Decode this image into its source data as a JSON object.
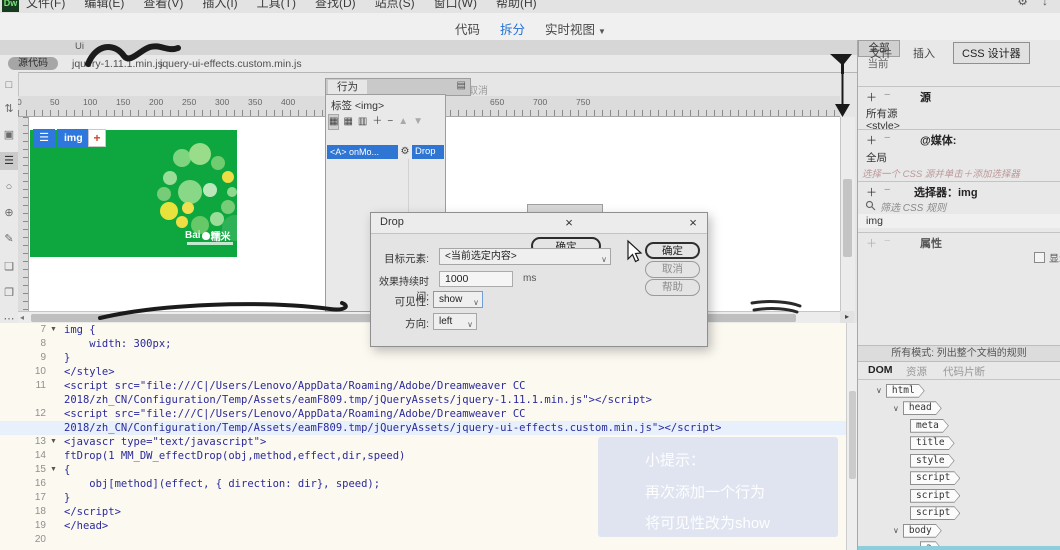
{
  "menu_bar": {
    "items": [
      "文件(F)",
      "编辑(E)",
      "查看(V)",
      "插入(I)",
      "工具(T)",
      "查找(D)",
      "站点(S)",
      "窗口(W)",
      "帮助(H)"
    ],
    "logo": "Dw"
  },
  "view_toolbar": {
    "code": "代码",
    "split": "拆分",
    "live": "实时视图"
  },
  "document_tabs": {
    "partial_title": "Ui"
  },
  "related_files": {
    "source": "源代码",
    "files": [
      "jquery-1.11.1.min.js",
      "jquery-ui-effects.custom.min.js"
    ]
  },
  "left_toolbar": {
    "icons": [
      {
        "name": "file-icon",
        "glyph": "□"
      },
      {
        "name": "manage-files-icon",
        "glyph": "⇅"
      },
      {
        "name": "live-view-icon",
        "glyph": "▣"
      },
      {
        "name": "format-menu-icon",
        "glyph": "☰",
        "active": true
      },
      {
        "name": "circle-marker-icon",
        "glyph": "○"
      },
      {
        "name": "guides-icon",
        "glyph": "⊕"
      },
      {
        "name": "edit-tool-icon",
        "glyph": "✎"
      },
      {
        "name": "comment-icon",
        "glyph": "❏"
      },
      {
        "name": "comment-remove-icon",
        "glyph": "❐"
      },
      {
        "name": "more-tools-icon",
        "glyph": "⋯"
      }
    ]
  },
  "design_view": {
    "img_badge": "img",
    "hud_menu_icon": "☰",
    "hud_plus": "+",
    "ruler": {
      "left_ticks": [
        "0",
        "50",
        "100",
        "150",
        "200",
        "250",
        "300",
        "350",
        "400"
      ],
      "right_ticks": [
        "650",
        "700",
        "750"
      ]
    },
    "image": {
      "logo_primary": "Bai",
      "logo_secondary": "糯米",
      "background_color": "#0ea73f",
      "bubbles": [
        [
          152,
          28,
          9,
          "#7fd47f"
        ],
        [
          170,
          24,
          11,
          "#99dd8a"
        ],
        [
          188,
          33,
          7,
          "#6fcc6f"
        ],
        [
          198,
          47,
          6,
          "#eedd44"
        ],
        [
          202,
          62,
          5,
          "#8fd98f"
        ],
        [
          198,
          77,
          7,
          "#77cc77"
        ],
        [
          187,
          89,
          7,
          "#99dd99"
        ],
        [
          170,
          95,
          9,
          "#66c866"
        ],
        [
          152,
          92,
          6,
          "#eedd44"
        ],
        [
          139,
          81,
          9,
          "#e8e23c"
        ],
        [
          134,
          64,
          7,
          "#77cc77"
        ],
        [
          140,
          48,
          7,
          "#99dd99"
        ],
        [
          160,
          62,
          12,
          "#88d888"
        ],
        [
          180,
          60,
          7,
          "#bbe8bb"
        ],
        [
          158,
          78,
          6,
          "#f0e050"
        ],
        [
          205,
          98,
          13,
          "#2fb157"
        ]
      ]
    }
  },
  "behaviors_panel": {
    "title": "行为",
    "menu_icon": "▤",
    "tag_label": "标签 <img>",
    "toolbar_icons": [
      {
        "name": "show-set-events-icon",
        "glyph": "▦",
        "pressed": true
      },
      {
        "name": "show-all-events-icon",
        "glyph": "▦"
      },
      {
        "name": "events-column-icon",
        "glyph": "▥"
      },
      {
        "name": "add-behavior-button",
        "glyph": "＋"
      },
      {
        "name": "remove-behavior-button",
        "glyph": "−"
      },
      {
        "name": "move-up-button",
        "glyph": "▲",
        "disabled": true
      },
      {
        "name": "move-down-button",
        "glyph": "▼",
        "disabled": true
      }
    ],
    "event": "<A> onMo...",
    "gear_icon": "⚙",
    "action": "Drop",
    "hidden_text": "取消"
  },
  "drop_dialog": {
    "title": "Drop",
    "close_icon": "×",
    "ghost_ok": "确定",
    "target_label": "目标元素:",
    "target_value": "<当前选定内容>",
    "duration_label": "效果持续时间:",
    "duration_value": "1000",
    "duration_unit": "ms",
    "visibility_label": "可见性:",
    "visibility_value": "show",
    "direction_label": "方向:",
    "direction_value": "left",
    "ok": "确定",
    "cancel": "取消",
    "help": "帮助"
  },
  "code_editor": {
    "rows": [
      {
        "n": "7",
        "fold": true,
        "text": "img {"
      },
      {
        "n": "8",
        "text": "    width: 300px;"
      },
      {
        "n": "9",
        "text": "}"
      },
      {
        "n": "10",
        "text": "</style>"
      },
      {
        "n": "11",
        "text": "<script src=\"file:///C|/Users/Lenovo/AppData/Roaming/Adobe/Dreamweaver CC"
      },
      {
        "n": "",
        "text": "2018/zh_CN/Configuration/Temp/Assets/eamF809.tmp/jQueryAssets/jquery-1.11.1.min.js\"></script>"
      },
      {
        "n": "12",
        "text": "<script src=\"file:///C|/Users/Lenovo/AppData/Roaming/Adobe/Dreamweaver CC"
      },
      {
        "n": "",
        "hl": true,
        "text": "2018/zh_CN/Configuration/Temp/Assets/eamF809.tmp/jQueryAssets/jquery-ui-effects.custom.min.js\"></script>"
      },
      {
        "n": "13",
        "fold": true,
        "text": "<javascr type=\"text/javascript\">"
      },
      {
        "n": "14",
        "text": "ftDrop(1 MM_DW_effectDrop(obj,method,effect,dir,speed)"
      },
      {
        "n": "15",
        "fold": true,
        "text": "{"
      },
      {
        "n": "16",
        "text": "    obj[method](effect, { direction: dir}, speed);"
      },
      {
        "n": "17",
        "text": "}"
      },
      {
        "n": "18",
        "text": "</script>"
      },
      {
        "n": "19",
        "text": "</head>"
      },
      {
        "n": "20",
        "text": ""
      }
    ]
  },
  "tip_overlay": {
    "lines": [
      "小提示：",
      "再次添加一个行为",
      "将可见性改为show"
    ]
  },
  "right_panel": {
    "tab_files": "文件",
    "tab_insert": "插入",
    "tab_css": "CSS 设计器",
    "mode_all": "全部",
    "mode_current": "当前",
    "sources_header": "源",
    "all_sources": "所有源",
    "style_item": "<style>",
    "media_header": "@媒体:",
    "media_global": "全局",
    "hint": "选择一个 CSS 源并单击＋添加选择器",
    "selectors_header": "选择器：img",
    "filter_placeholder": "筛选 CSS 规则",
    "selector_item": "img",
    "properties_header": "属性",
    "show_set": "显示集",
    "status": "所有模式: 列出整个文档的规则",
    "dom_tabs": [
      "DOM",
      "资源",
      "代码片断"
    ],
    "dom_tree": [
      {
        "tag": "html",
        "depth": 0,
        "chev": true
      },
      {
        "tag": "head",
        "depth": 1,
        "chev": true
      },
      {
        "tag": "meta",
        "depth": 2
      },
      {
        "tag": "title",
        "depth": 2
      },
      {
        "tag": "style",
        "depth": 2
      },
      {
        "tag": "script",
        "depth": 2
      },
      {
        "tag": "script",
        "depth": 2
      },
      {
        "tag": "script",
        "depth": 2
      },
      {
        "tag": "body",
        "depth": 1,
        "chev": true
      },
      {
        "tag": "a",
        "depth": 2,
        "chev": true
      }
    ]
  },
  "colors": {
    "accent_blue": "#2170d6",
    "selection_blue": "#2e75d4",
    "image_green": "#0ea73f",
    "code_navy": "#2a2a9c"
  }
}
